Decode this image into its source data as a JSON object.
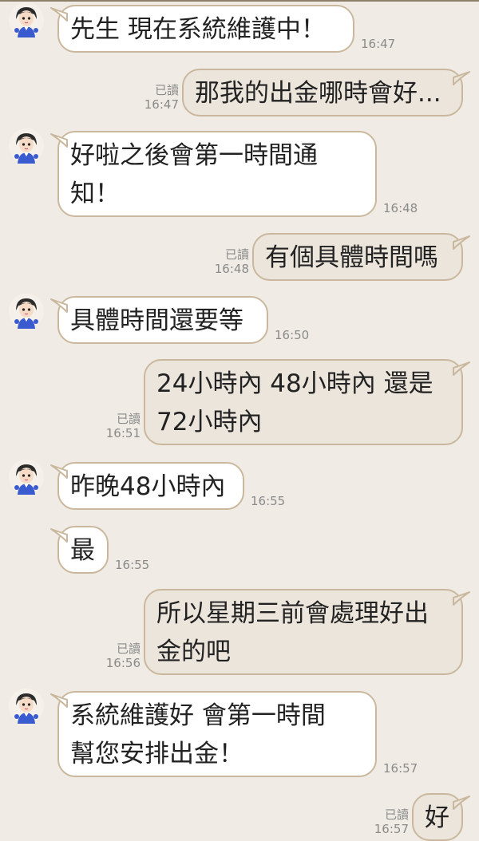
{
  "read_label": "已讀",
  "colors": {
    "background": "#f0ece5",
    "incoming_bubble": "#ffffff",
    "outgoing_bubble": "#ece5dc",
    "bubble_border": "#c9b89d",
    "timestamp": "#8a8a8a"
  },
  "avatar_icon": "agent-avatar-icon",
  "messages": [
    {
      "id": "m1",
      "dir": "in",
      "avatar": true,
      "lines": [
        "先生 現在系統維護中！"
      ],
      "time": "16:47"
    },
    {
      "id": "m2",
      "dir": "out",
      "lines": [
        "那我的出金哪時會好..."
      ],
      "time": "16:47",
      "read": true
    },
    {
      "id": "m3",
      "dir": "in",
      "avatar": true,
      "lines": [
        "好啦之後會第一時間通",
        "知！"
      ],
      "time": "16:48"
    },
    {
      "id": "m4",
      "dir": "out",
      "lines": [
        "有個具體時間嗎"
      ],
      "time": "16:48",
      "read": true
    },
    {
      "id": "m5",
      "dir": "in",
      "avatar": true,
      "lines": [
        "具體時間還要等"
      ],
      "time": "16:50"
    },
    {
      "id": "m6",
      "dir": "out",
      "lines": [
        "24小時內 48小時內 還是",
        "72小時內"
      ],
      "time": "16:51",
      "read": true
    },
    {
      "id": "m7",
      "dir": "in",
      "avatar": true,
      "lines": [
        "昨晚48小時內"
      ],
      "time": "16:55"
    },
    {
      "id": "m8",
      "dir": "in",
      "avatar": false,
      "lines": [
        "最"
      ],
      "time": "16:55"
    },
    {
      "id": "m9",
      "dir": "out",
      "lines": [
        "所以星期三前會處理好出",
        "金的吧"
      ],
      "time": "16:56",
      "read": true
    },
    {
      "id": "m10",
      "dir": "in",
      "avatar": true,
      "lines": [
        "系統維護好 會第一時間",
        "幫您安排出金！"
      ],
      "time": "16:57"
    },
    {
      "id": "m11",
      "dir": "out",
      "lines": [
        "好"
      ],
      "time": "16:57",
      "read": true
    }
  ]
}
